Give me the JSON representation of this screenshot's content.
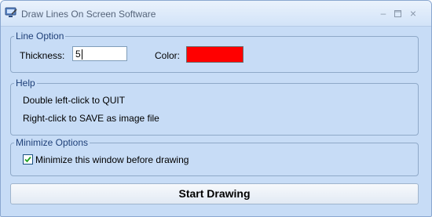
{
  "window": {
    "title": "Draw Lines On Screen Software",
    "icon": "monitor-pen-icon",
    "controls": {
      "minimize": "minimize-icon",
      "maximize": "maximize-icon",
      "close": "close-icon"
    }
  },
  "line_option": {
    "legend": "Line Option",
    "thickness_label": "Thickness:",
    "thickness_value": "5",
    "color_label": "Color:",
    "color_value": "#ff0000"
  },
  "help": {
    "legend": "Help",
    "line1": "Double left-click to QUIT",
    "line2": "Right-click to SAVE as image file"
  },
  "minimize_options": {
    "legend": "Minimize Options",
    "checkbox_label": "Minimize this window before drawing",
    "checked": true
  },
  "start_button": {
    "label": "Start Drawing"
  },
  "colors": {
    "window_bg": "#c7dcf6",
    "group_border": "#8fa9c8",
    "legend_text": "#1e3f78",
    "title_text": "#55647a"
  }
}
